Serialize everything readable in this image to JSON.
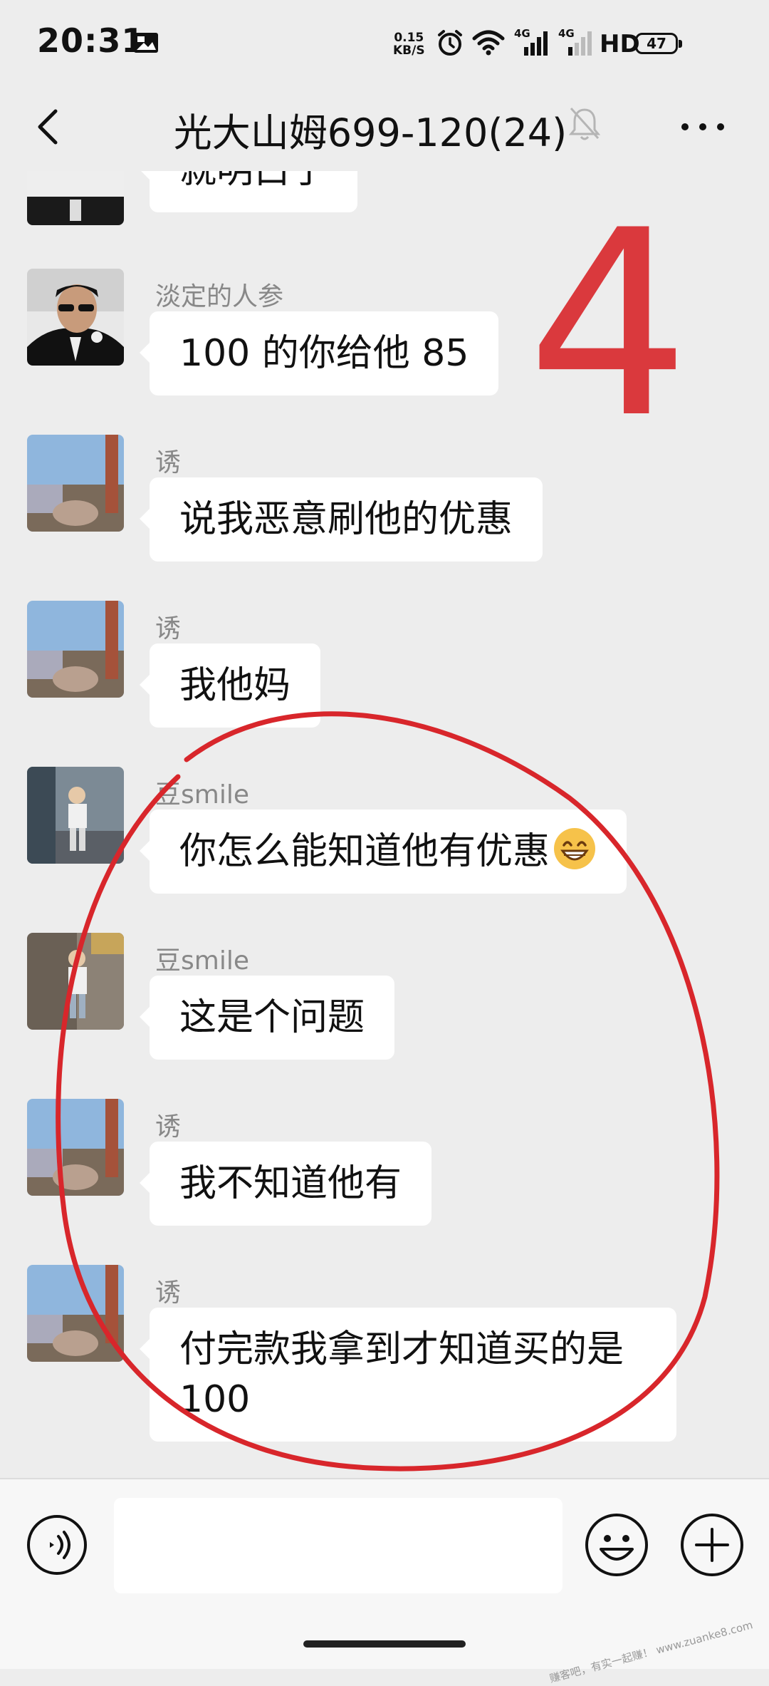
{
  "status_bar": {
    "time": "20:31",
    "net_speed_value": "0.15",
    "net_speed_unit": "KB/S",
    "network_label_1": "4G",
    "network_label_2": "4G",
    "hd_label": "HD",
    "battery": "47"
  },
  "header": {
    "title": "光大山姆699-120(24)"
  },
  "messages": [
    {
      "sender": "",
      "text": "就明白了"
    },
    {
      "sender": "淡定的人参",
      "text": "100 的你给他 85"
    },
    {
      "sender": "诱",
      "text": "说我恶意刷他的优惠"
    },
    {
      "sender": "诱",
      "text": "我他妈"
    },
    {
      "sender": "豆smile",
      "text": "你怎么能知道他有优惠"
    },
    {
      "sender": "豆smile",
      "text": "这是个问题"
    },
    {
      "sender": "诱",
      "text": "我不知道他有"
    },
    {
      "sender": "诱",
      "text": "付完款我拿到才知道买的是100"
    }
  ],
  "annotation": {
    "number": "4",
    "color": "#d8262b"
  },
  "icons": {
    "back": "back-arrow-icon",
    "mute": "bell-off-icon",
    "more": "more-dots-icon",
    "voice": "voice-icon",
    "emoji": "emoji-icon",
    "plus": "plus-icon"
  },
  "input": {
    "value": ""
  },
  "watermark": "赚客吧，有实一起赚！ www.zuanke8.com"
}
